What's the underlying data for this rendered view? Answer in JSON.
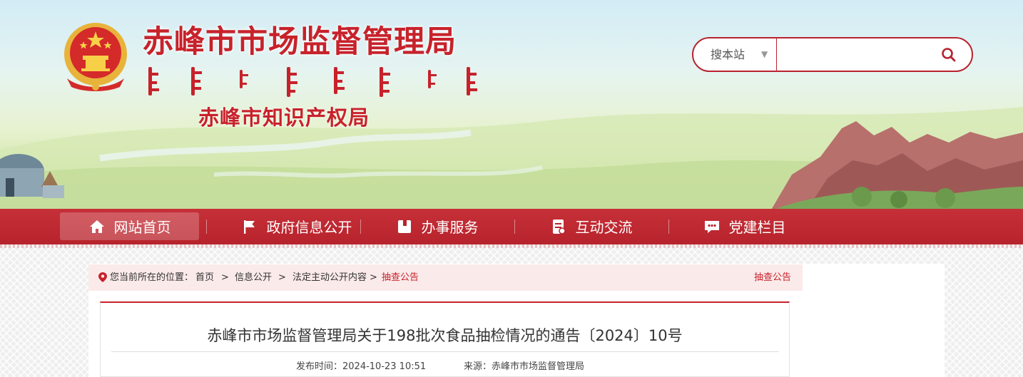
{
  "header": {
    "title": "赤峰市市场监督管理局",
    "subtitle": "赤峰市知识产权局"
  },
  "search": {
    "scope_label": "搜本站",
    "scope_caret": "▼",
    "placeholder": ""
  },
  "nav": {
    "items": [
      {
        "label": "网站首页",
        "icon": "home-icon",
        "active": true
      },
      {
        "label": "政府信息公开",
        "icon": "flag-icon",
        "active": false
      },
      {
        "label": "办事服务",
        "icon": "folder-icon",
        "active": false
      },
      {
        "label": "互动交流",
        "icon": "document-icon",
        "active": false
      },
      {
        "label": "党建栏目",
        "icon": "chat-icon",
        "active": false
      }
    ]
  },
  "breadcrumb": {
    "location_label": "您当前所在的位置：",
    "items": [
      "首页",
      "信息公开",
      "法定主动公开内容",
      "抽查公告"
    ],
    "separator": ">",
    "column_name": "抽查公告"
  },
  "article": {
    "title": "赤峰市市场监督管理局关于198批次食品抽检情况的通告〔2024〕10号",
    "publish_time": "发布时间：2024-10-23 10:51",
    "source": "来源：赤峰市市场监督管理局"
  },
  "colors": {
    "brand_red": "#c7222b",
    "nav_red": "#b7232c",
    "breadcrumb_bg": "#fbeaea"
  }
}
